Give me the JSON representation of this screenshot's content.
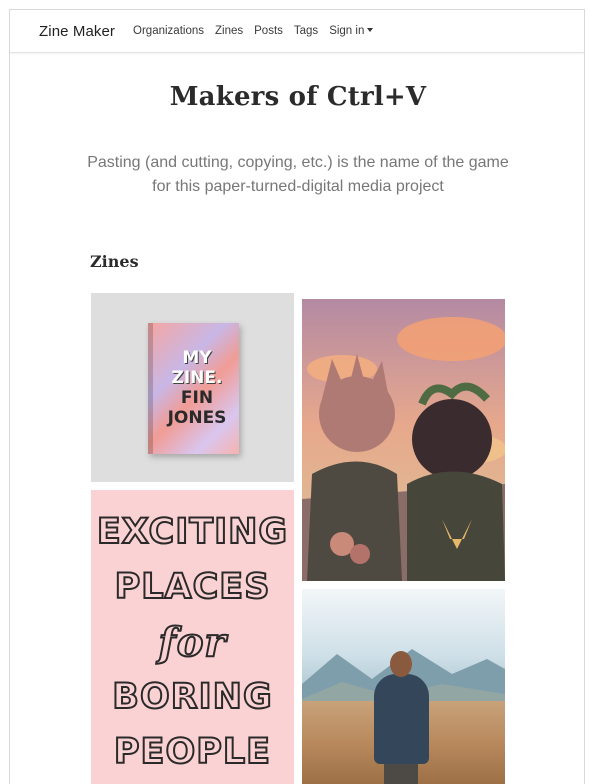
{
  "navbar": {
    "brand": "Zine Maker",
    "links": [
      "Organizations",
      "Zines",
      "Posts",
      "Tags"
    ],
    "signin": "Sign in"
  },
  "hero": {
    "title": "Makers of Ctrl+V",
    "subtitle": "Pasting (and cutting, copying, etc.) is the name of the game for this paper-turned-digital media project"
  },
  "zines_section": {
    "heading": "Zines",
    "tiles": [
      {
        "cover_lines": [
          "MY",
          "ZINE.",
          "FIN",
          "JONES"
        ]
      },
      {
        "cover_lines": []
      },
      {
        "cover_lines": [
          "EXCITING",
          "PLACES",
          "for",
          "BORING",
          "PEOPLE"
        ]
      },
      {
        "cover_lines": []
      }
    ]
  },
  "colors": {
    "brand_text": "#222222",
    "subtitle_text": "#777777",
    "poster_bg": "#fbd2d3"
  }
}
